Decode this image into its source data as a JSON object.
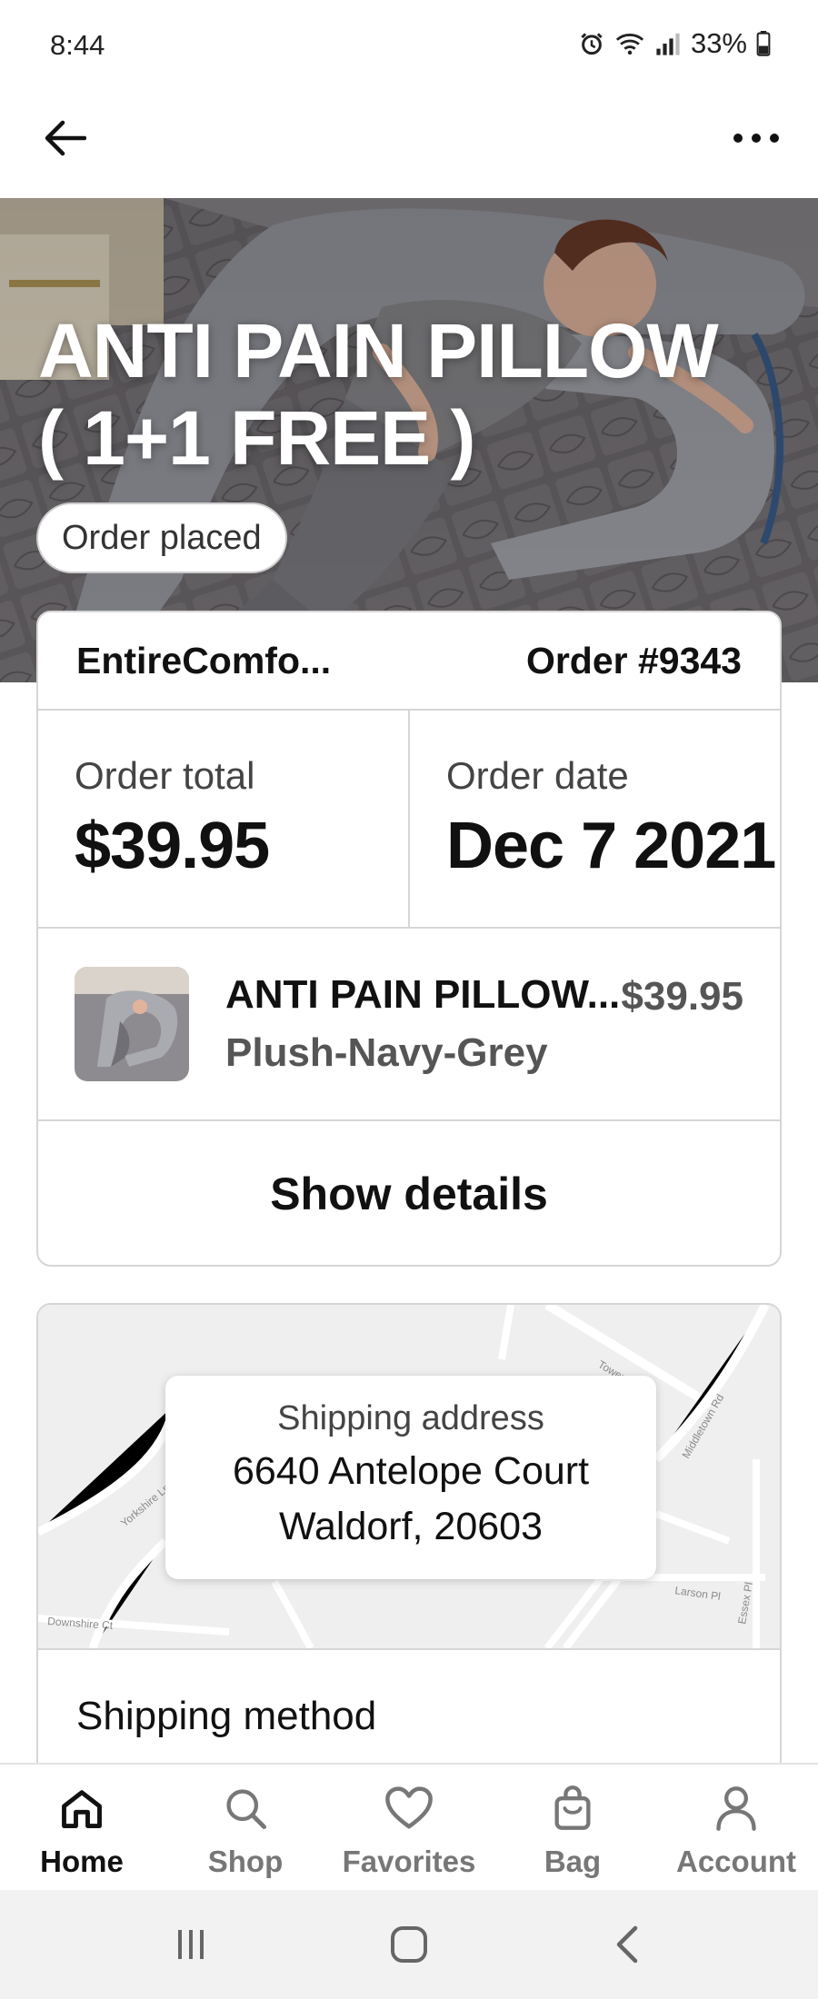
{
  "status_bar": {
    "time": "8:44",
    "battery": "33%",
    "icons": [
      "alarm-icon",
      "wifi-icon",
      "signal-icon",
      "battery-icon"
    ]
  },
  "app_bar": {
    "back_icon": "arrow-left-icon",
    "more_icon": "more-horizontal-icon"
  },
  "hero": {
    "title_line1": "ANTI PAIN PILLOW",
    "title_line2": "( 1+1 FREE )",
    "status": "Order placed"
  },
  "order": {
    "store": "EntireComfo...",
    "number": "Order #9343",
    "total_label": "Order total",
    "total_value": "$39.95",
    "date_label": "Order date",
    "date_value": "Dec 7 2021",
    "item": {
      "name": "ANTI PAIN PILLOW...",
      "variant": "Plush-Navy-Grey",
      "price": "$39.95"
    },
    "show_details": "Show details"
  },
  "shipping": {
    "address_label": "Shipping address",
    "address_line1": "6640 Antelope Court",
    "address_line2": "Waldorf, 20603",
    "method_title": "Shipping method",
    "map_labels": {
      "a": "Tower Mill Ln",
      "b": "Middletown Rd",
      "c": "Yorkshire Ln",
      "d": "Larson Pl",
      "e": "Downshire Ct",
      "f": "Essex Pl"
    }
  },
  "bottom_nav": {
    "items": [
      {
        "label": "Home",
        "icon": "home-icon"
      },
      {
        "label": "Shop",
        "icon": "search-icon"
      },
      {
        "label": "Favorites",
        "icon": "heart-icon"
      },
      {
        "label": "Bag",
        "icon": "bag-icon"
      },
      {
        "label": "Account",
        "icon": "person-icon"
      }
    ],
    "active": "Home"
  },
  "colors": {
    "text": "#111111",
    "muted": "#777777",
    "border": "#d6d6d6",
    "map_bg": "#efefef"
  }
}
